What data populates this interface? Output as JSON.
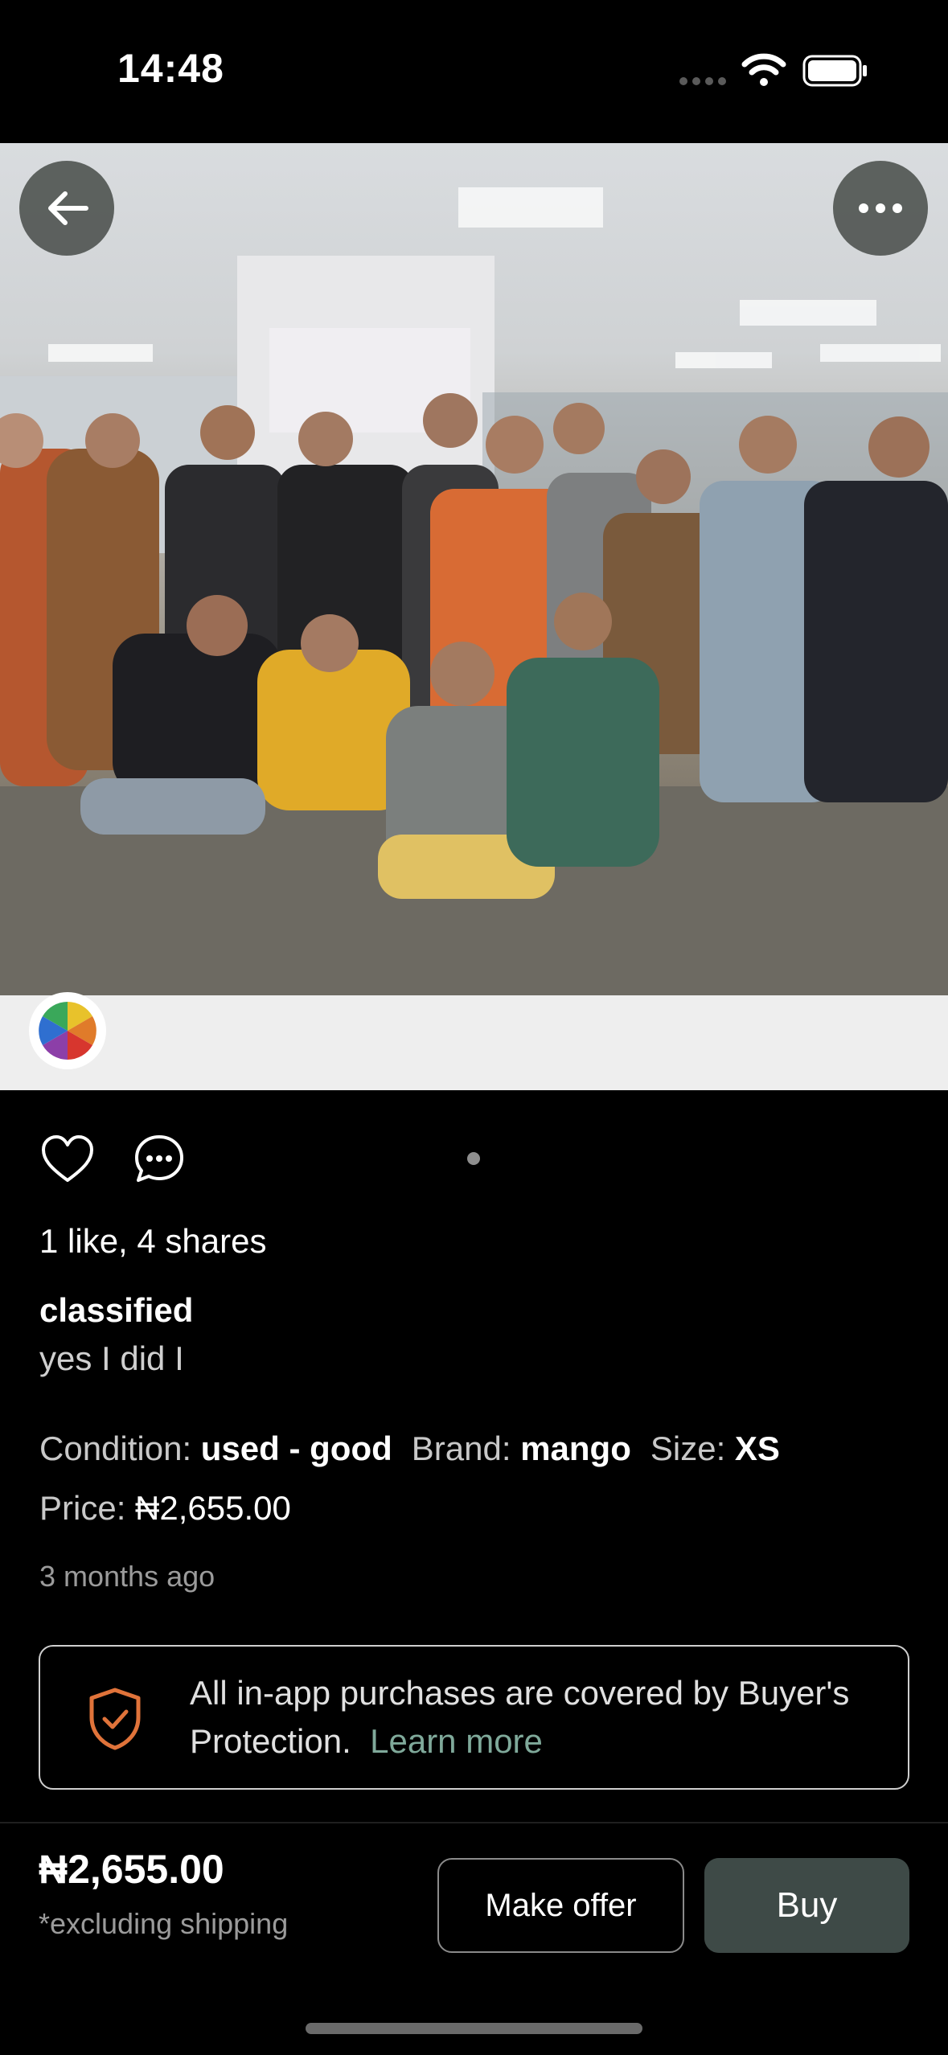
{
  "status_bar": {
    "time": "14:48"
  },
  "listing": {
    "likes_shares": "1 like, 4 shares",
    "title": "classified",
    "description": "yes I did I",
    "condition_label": "Condition:",
    "condition_value": "used - good",
    "brand_label": "Brand:",
    "brand_value": "mango",
    "size_label": "Size:",
    "size_value": "XS",
    "price_label": "Price:",
    "price_value": "₦2,655.00",
    "posted": "3 months ago"
  },
  "protection": {
    "text": "All in-app purchases are covered by Buyer's Protection.",
    "link": "Learn more"
  },
  "bottom_bar": {
    "price": "₦2,655.00",
    "shipping_note": "*excluding shipping",
    "offer_label": "Make offer",
    "buy_label": "Buy"
  },
  "icons": {
    "back": "arrow-left-icon",
    "more": "ellipsis-icon",
    "like": "heart-icon",
    "comment": "chat-bubble-icon",
    "shield": "shield-check-icon",
    "color_wheel": "color-wheel-icon"
  },
  "colors": {
    "background": "#000000",
    "accent_link": "#7fa99a",
    "shield": "#e0733a",
    "buy_button": "#3e4a47"
  }
}
